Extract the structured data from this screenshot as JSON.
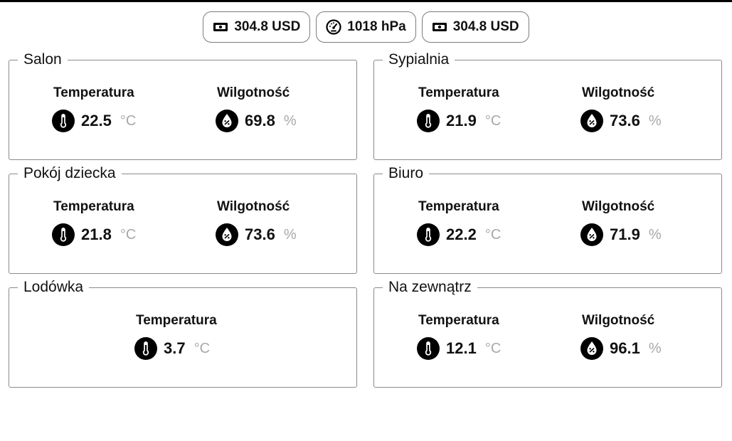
{
  "header_badges": [
    {
      "icon": "cash-icon",
      "value": "304.8 USD"
    },
    {
      "icon": "gauge-icon",
      "value": "1018 hPa"
    },
    {
      "icon": "cash-icon",
      "value": "304.8 USD"
    }
  ],
  "labels": {
    "temperature": "Temperatura",
    "humidity": "Wilgotność"
  },
  "units": {
    "temperature": "°C",
    "humidity": "%"
  },
  "rooms": [
    {
      "name": "Salon",
      "temperature": "22.5",
      "humidity": "69.8"
    },
    {
      "name": "Sypialnia",
      "temperature": "21.9",
      "humidity": "73.6"
    },
    {
      "name": "Pokój dziecka",
      "temperature": "21.8",
      "humidity": "73.6"
    },
    {
      "name": "Biuro",
      "temperature": "22.2",
      "humidity": "71.9"
    },
    {
      "name": "Lodówka",
      "temperature": "3.7"
    },
    {
      "name": "Na zewnątrz",
      "temperature": "12.1",
      "humidity": "96.1"
    }
  ],
  "colors": {
    "icon": "#000000",
    "unit_text": "#a8a8a8",
    "border": "#8a8a8a"
  }
}
